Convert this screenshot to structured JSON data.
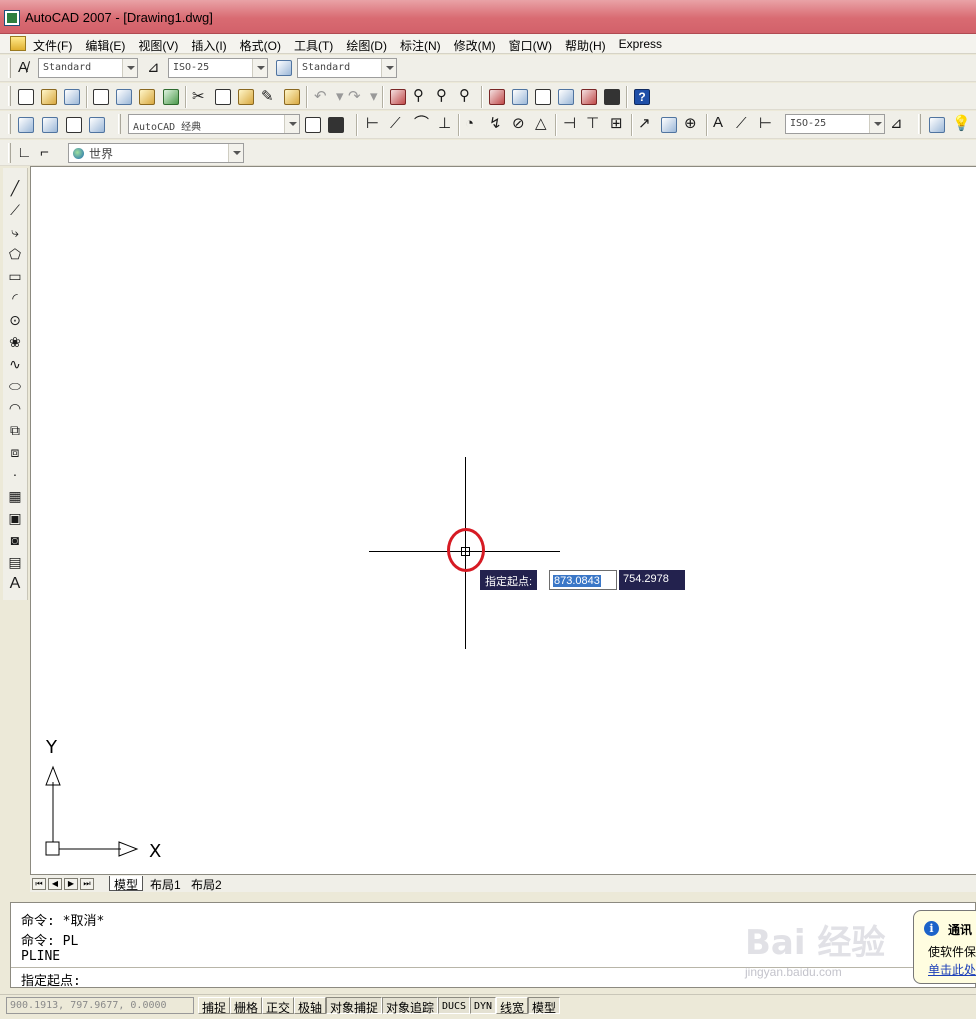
{
  "window": {
    "title": "AutoCAD 2007 - [Drawing1.dwg]"
  },
  "menu": [
    "文件(F)",
    "编辑(E)",
    "视图(V)",
    "插入(I)",
    "格式(O)",
    "工具(T)",
    "绘图(D)",
    "标注(N)",
    "修改(M)",
    "窗口(W)",
    "帮助(H)",
    "Express"
  ],
  "styles_toolbar": {
    "text_style": "Standard",
    "dim_style": "ISO-25",
    "table_style": "Standard"
  },
  "workspace_toolbar": {
    "workspace": "AutoCAD 经典"
  },
  "dim_toolbar": {
    "dim_style": "ISO-25"
  },
  "ucs_toolbar": {
    "ucs": "世界"
  },
  "dynamic_input": {
    "prompt": "指定起点:",
    "x_value": "873.0843",
    "y_value": "754.2978"
  },
  "ucs_icon": {
    "x_label": "X",
    "y_label": "Y"
  },
  "layout_tabs": [
    "模型",
    "布局1",
    "布局2"
  ],
  "command_history": [
    "命令: *取消*",
    "命令: PL",
    "PLINE"
  ],
  "command_prompt": "指定起点:",
  "notification": {
    "title": "通讯",
    "line1": "使软件保",
    "link": "单击此处"
  },
  "status": {
    "coordinates": "900.1913, 797.9677, 0.0000",
    "toggles": [
      {
        "label": "捕捉",
        "on": false
      },
      {
        "label": "栅格",
        "on": false
      },
      {
        "label": "正交",
        "on": false
      },
      {
        "label": "极轴",
        "on": false
      },
      {
        "label": "对象捕捉",
        "on": true
      },
      {
        "label": "对象追踪",
        "on": true
      },
      {
        "label": "DUCS",
        "on": true
      },
      {
        "label": "DYN",
        "on": true
      },
      {
        "label": "线宽",
        "on": false
      },
      {
        "label": "模型",
        "on": true
      }
    ]
  },
  "watermark": {
    "brand": "Bai 经验",
    "url": "jingyan.baidu.com"
  },
  "colors": {
    "highlight": "#d61a23",
    "dyn_bg": "#23224e",
    "title_bar": "#d96b72"
  }
}
